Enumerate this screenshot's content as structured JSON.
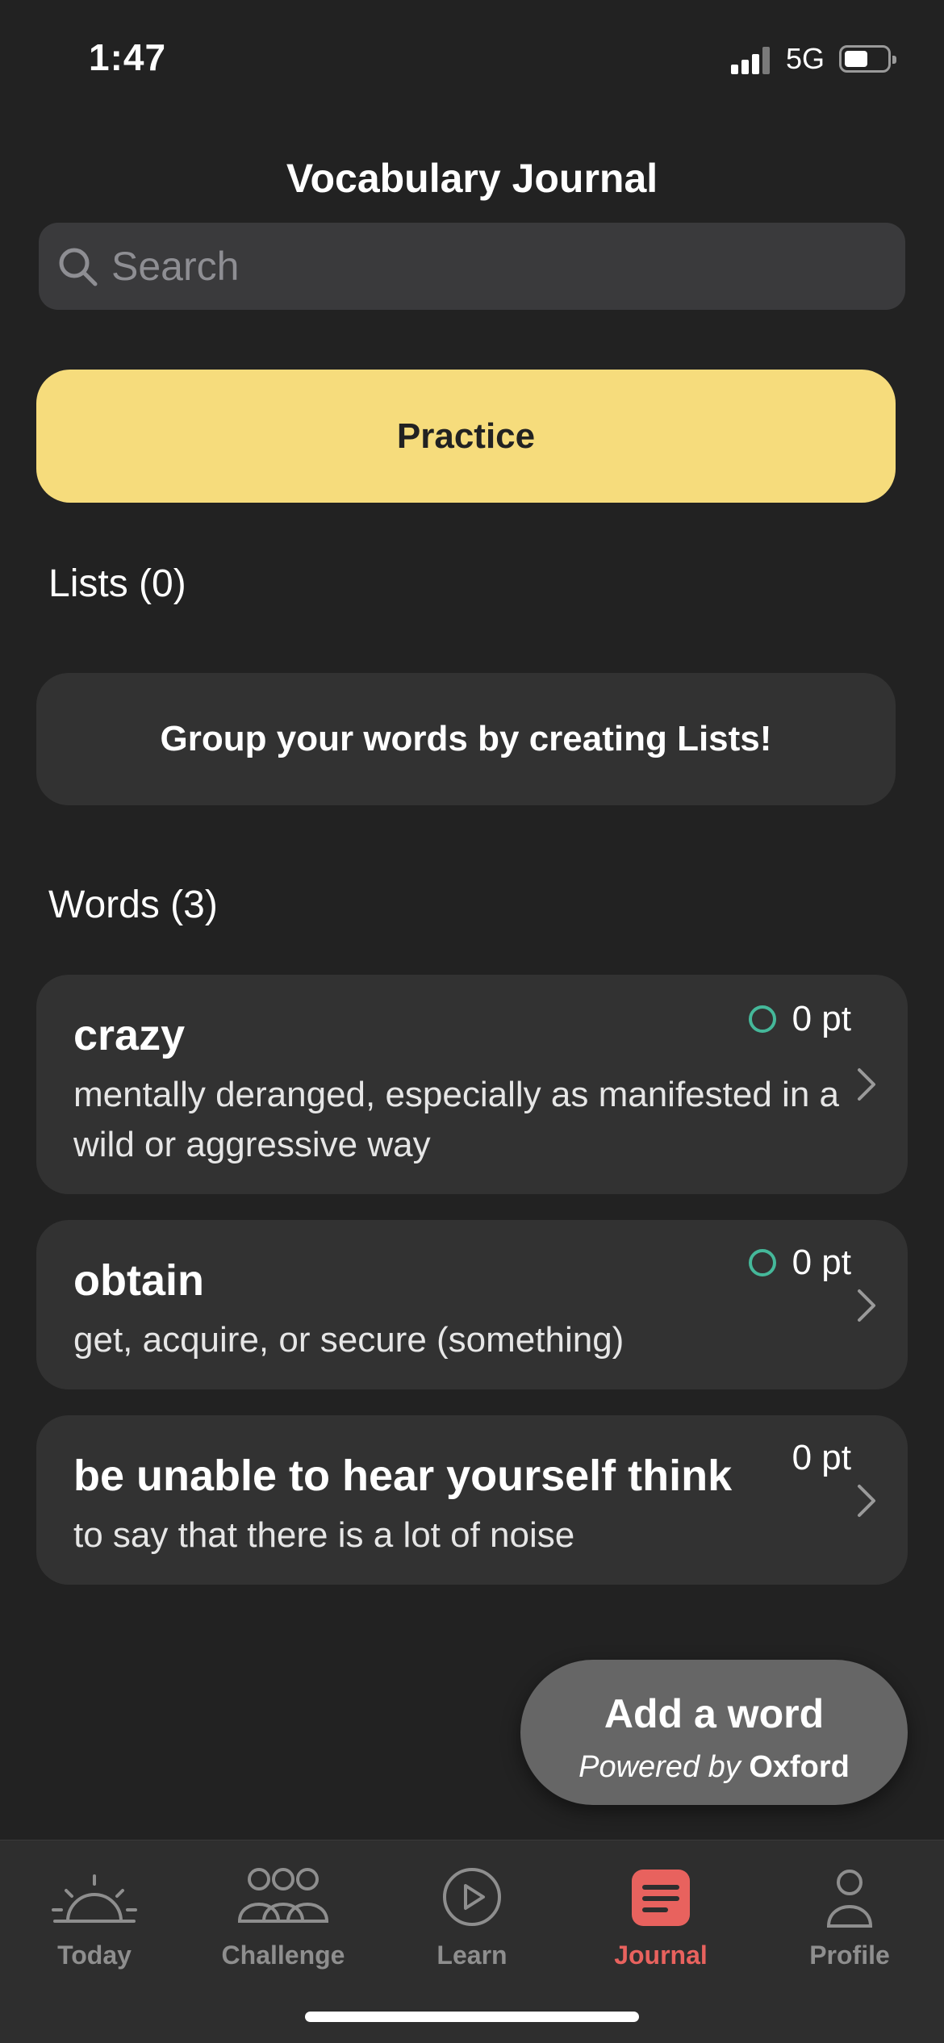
{
  "status": {
    "time": "1:47",
    "network": "5G"
  },
  "header": {
    "title": "Vocabulary Journal"
  },
  "search": {
    "placeholder": "Search"
  },
  "practice": {
    "label": "Practice"
  },
  "lists": {
    "heading": "Lists (0)",
    "empty_message": "Group your words by creating Lists!"
  },
  "words": {
    "heading": "Words (3)",
    "items": [
      {
        "term": "crazy",
        "definition": "mentally deranged, especially as manifested in a wild or aggressive way",
        "points": "0 pt"
      },
      {
        "term": "obtain",
        "definition": "get, acquire, or secure (something)",
        "points": "0 pt"
      },
      {
        "term": "be unable to hear yourself think",
        "definition": "to say that there is a lot of noise",
        "points": "0 pt"
      }
    ]
  },
  "add_word": {
    "label": "Add a word",
    "powered_prefix": "Powered by",
    "powered_brand": "Oxford"
  },
  "tabs": [
    {
      "label": "Today",
      "icon": "sunrise-icon"
    },
    {
      "label": "Challenge",
      "icon": "group-icon"
    },
    {
      "label": "Learn",
      "icon": "play-circle-icon"
    },
    {
      "label": "Journal",
      "icon": "journal-icon",
      "active": true
    },
    {
      "label": "Profile",
      "icon": "person-icon"
    }
  ],
  "colors": {
    "background": "#222222",
    "card": "#323232",
    "practice": "#f6dc7c",
    "accent_active": "#e8625e",
    "points_ring": "#45b89a"
  }
}
